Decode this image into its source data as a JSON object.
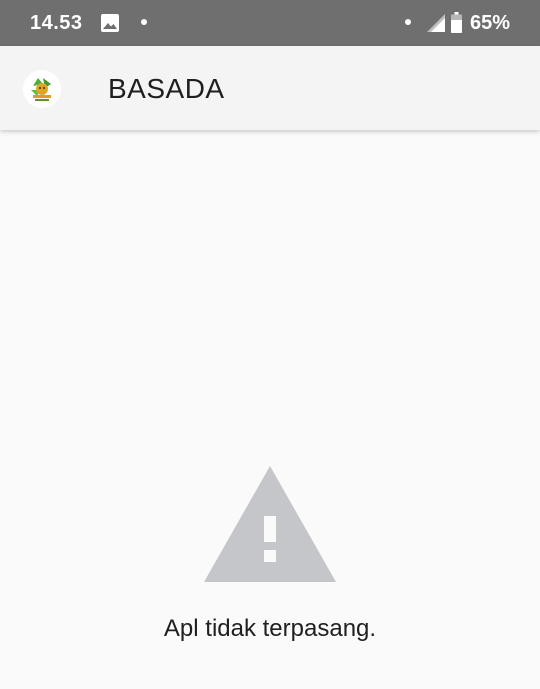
{
  "status_bar": {
    "time": "14.53",
    "battery": "65%",
    "icons": [
      "image-icon",
      "notification-dot-icon",
      "signal-icon",
      "battery-icon"
    ]
  },
  "app_bar": {
    "title": "BASADA",
    "logo_icon": "basada-logo-icon"
  },
  "content": {
    "warning_icon": "warning-triangle-icon",
    "message": "Apl tidak terpasang."
  },
  "colors": {
    "status_bar_bg": "#6f6f6f",
    "app_bar_bg": "#f4f4f4",
    "page_bg": "#fafafa",
    "warning_gray": "#c4c6c9",
    "text": "#1f1f1f"
  }
}
